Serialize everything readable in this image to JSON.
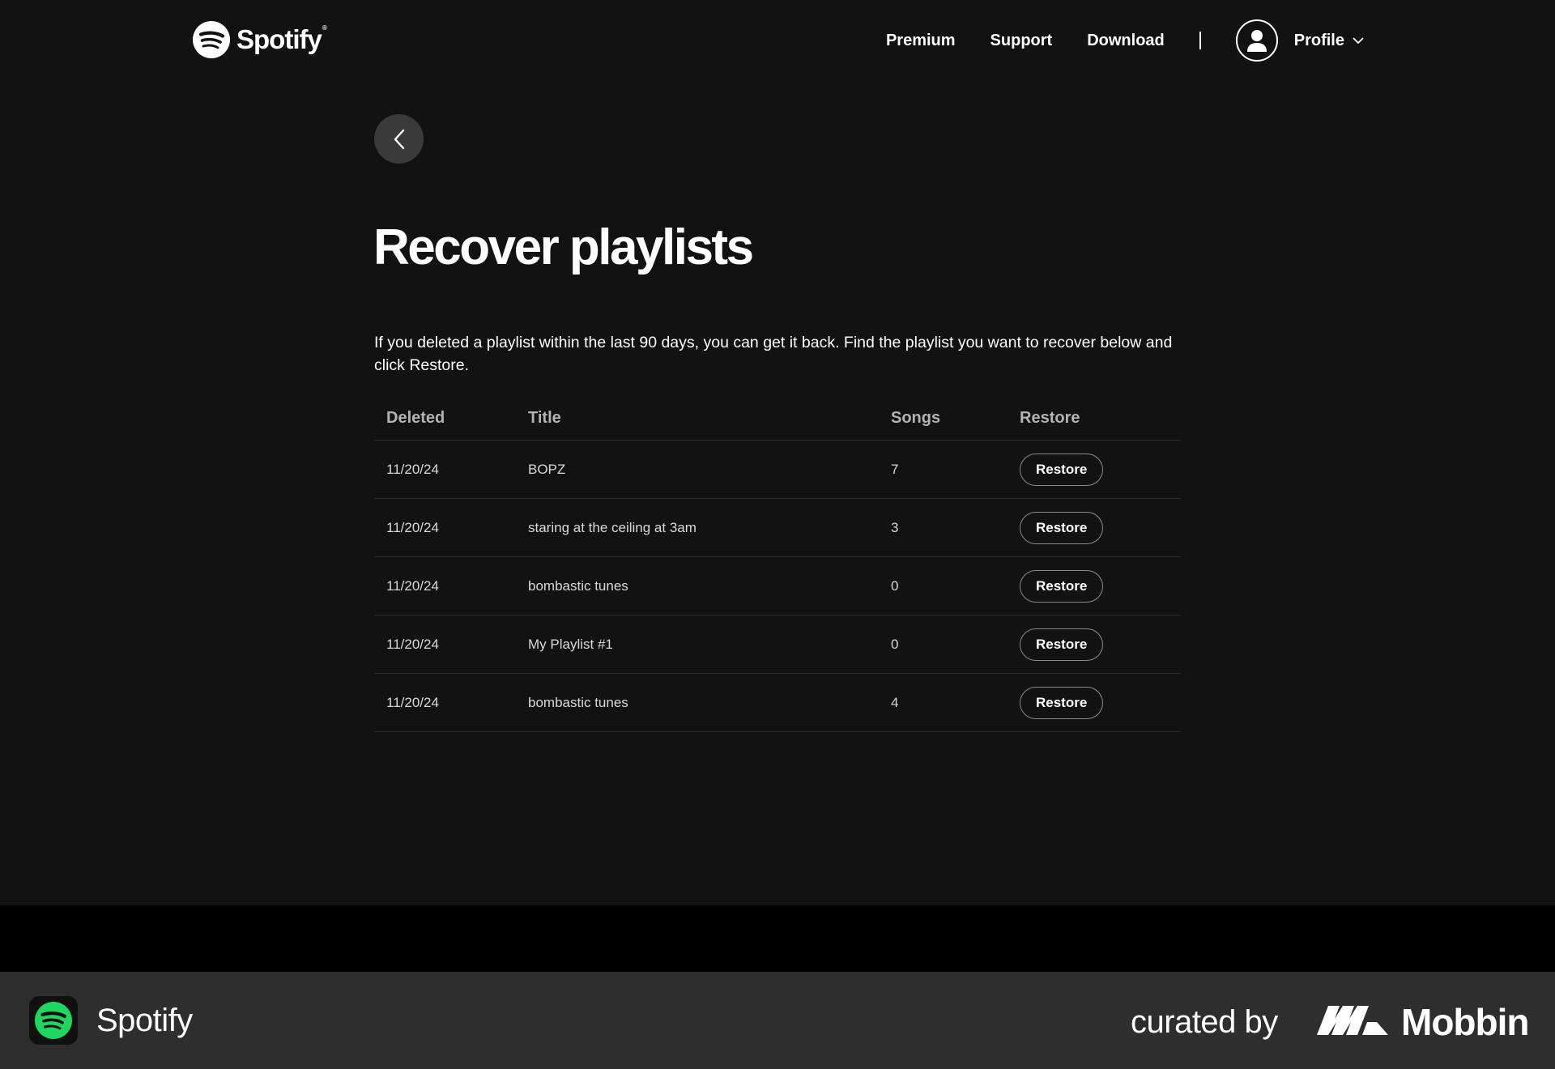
{
  "header": {
    "brand": "Spotify",
    "brand_mark": "®",
    "nav": {
      "premium": "Premium",
      "support": "Support",
      "download": "Download"
    },
    "profile_label": "Profile"
  },
  "main": {
    "title": "Recover playlists",
    "description": "If you deleted a playlist within the last 90 days, you can get it back. Find the playlist you want to recover below and click Restore.",
    "table": {
      "headers": {
        "deleted": "Deleted",
        "title": "Title",
        "songs": "Songs",
        "restore": "Restore"
      },
      "rows": [
        {
          "deleted": "11/20/24",
          "title": "BOPZ",
          "songs": "7",
          "action": "Restore"
        },
        {
          "deleted": "11/20/24",
          "title": "staring at the ceiling at 3am",
          "songs": "3",
          "action": "Restore"
        },
        {
          "deleted": "11/20/24",
          "title": "bombastic tunes",
          "songs": "0",
          "action": "Restore"
        },
        {
          "deleted": "11/20/24",
          "title": "My Playlist #1",
          "songs": "0",
          "action": "Restore"
        },
        {
          "deleted": "11/20/24",
          "title": "bombastic tunes",
          "songs": "4",
          "action": "Restore"
        }
      ]
    }
  },
  "footer": {
    "app_name": "Spotify",
    "curated_by": "curated by",
    "curator": "Mobbin"
  },
  "colors": {
    "background": "#121212",
    "footer_bar": "#2e2e2e",
    "spotify_green": "#1ed760",
    "back_button": "#3a3a3a"
  },
  "icons": {
    "brand": "spotify-logo-icon",
    "avatar": "user-icon",
    "chevron": "chevron-down-icon",
    "back": "chevron-left-icon",
    "curator": "mobbin-logo-icon"
  }
}
